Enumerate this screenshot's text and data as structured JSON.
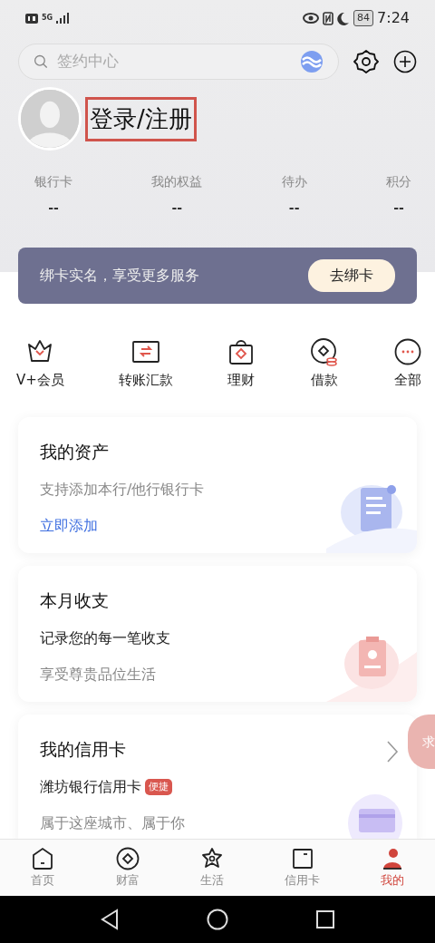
{
  "status_bar": {
    "network": "5G",
    "battery": "84",
    "time": "7:24"
  },
  "search": {
    "placeholder": "签约中心"
  },
  "profile": {
    "login": "登录/注册",
    "highlighted": true
  },
  "stats": [
    {
      "label": "银行卡",
      "value": "--"
    },
    {
      "label": "我的权益",
      "value": "--"
    },
    {
      "label": "待办",
      "value": "--"
    },
    {
      "label": "积分",
      "value": "--"
    }
  ],
  "banner": {
    "text": "绑卡实名，享受更多服务",
    "button": "去绑卡"
  },
  "shortcuts": [
    {
      "label": "V+会员",
      "kind": "crown"
    },
    {
      "label": "转账汇款",
      "kind": "transfer"
    },
    {
      "label": "理财",
      "kind": "bag"
    },
    {
      "label": "借款",
      "kind": "coin"
    },
    {
      "label": "全部",
      "kind": "more"
    }
  ],
  "cards": [
    {
      "kind": "assets",
      "title": "我的资产",
      "line_1": "支持添加本行/他行银行卡",
      "link": "立即添加"
    },
    {
      "kind": "budget",
      "title": "本月收支",
      "line_1": "记录您的每一笔收支",
      "line_2": "享受尊贵品位生活"
    },
    {
      "kind": "credit",
      "title": "我的信用卡",
      "line_1": "潍坊银行信用卡",
      "tag": "便捷",
      "line_2": "属于这座城市、属于你"
    }
  ],
  "float_button": {
    "label": "求"
  },
  "tab_bar": [
    {
      "label": "首页",
      "kind": "home",
      "selected": false
    },
    {
      "label": "财富",
      "kind": "wealth",
      "selected": false
    },
    {
      "label": "生活",
      "kind": "life",
      "selected": false
    },
    {
      "label": "信用卡",
      "kind": "card",
      "selected": false
    },
    {
      "label": "我的",
      "kind": "me",
      "selected": true
    }
  ]
}
